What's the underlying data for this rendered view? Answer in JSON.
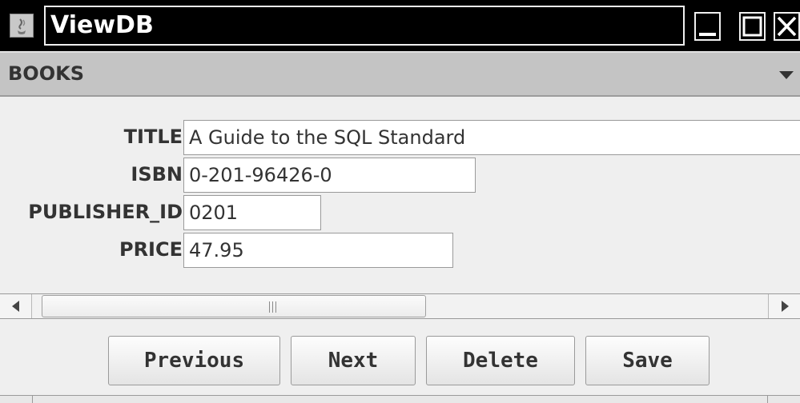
{
  "window": {
    "title": "ViewDB",
    "controls": {
      "minimize_icon": "minimize-icon",
      "maximize_icon": "maximize-icon",
      "close_icon": "close-icon"
    }
  },
  "table_selector": {
    "selected": "BOOKS"
  },
  "form": {
    "fields": [
      {
        "label": "TITLE",
        "value": "A Guide to the SQL Standard"
      },
      {
        "label": "ISBN",
        "value": "0-201-96426-0"
      },
      {
        "label": "PUBLISHER_ID",
        "value": "0201"
      },
      {
        "label": "PRICE",
        "value": "47.95"
      }
    ]
  },
  "scrollbar": {
    "left_arrow": "◀",
    "right_arrow": "▶"
  },
  "buttons": {
    "previous": "Previous",
    "next": "Next",
    "delete": "Delete",
    "save": "Save"
  },
  "colors": {
    "titlebar": "#000000",
    "window_bg": "#efefef",
    "combo_bg": "#c4c4c4"
  }
}
